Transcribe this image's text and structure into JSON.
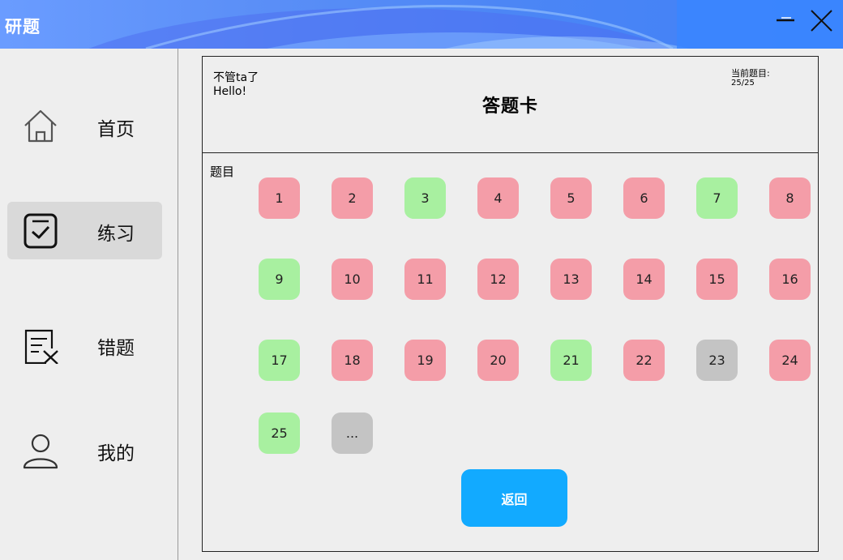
{
  "window": {
    "title": "研题"
  },
  "sidebar": {
    "items": [
      {
        "label": "首页",
        "icon": "home-icon"
      },
      {
        "label": "练习",
        "icon": "practice-check-icon",
        "active": true
      },
      {
        "label": "错题",
        "icon": "wrong-questions-icon"
      },
      {
        "label": "我的",
        "icon": "user-icon"
      }
    ]
  },
  "header": {
    "user_name": "不管ta了",
    "greeting": "Hello!",
    "title": "答题卡",
    "current_label": "当前题目:",
    "current_value": "25/25"
  },
  "questions": {
    "section_label": "题目",
    "items": [
      {
        "label": "1",
        "status": "wrong"
      },
      {
        "label": "2",
        "status": "wrong"
      },
      {
        "label": "3",
        "status": "right"
      },
      {
        "label": "4",
        "status": "wrong"
      },
      {
        "label": "5",
        "status": "wrong"
      },
      {
        "label": "6",
        "status": "wrong"
      },
      {
        "label": "7",
        "status": "right"
      },
      {
        "label": "8",
        "status": "wrong"
      },
      {
        "label": "9",
        "status": "right"
      },
      {
        "label": "10",
        "status": "wrong"
      },
      {
        "label": "11",
        "status": "wrong"
      },
      {
        "label": "12",
        "status": "wrong"
      },
      {
        "label": "13",
        "status": "wrong"
      },
      {
        "label": "14",
        "status": "wrong"
      },
      {
        "label": "15",
        "status": "wrong"
      },
      {
        "label": "16",
        "status": "wrong"
      },
      {
        "label": "17",
        "status": "right"
      },
      {
        "label": "18",
        "status": "wrong"
      },
      {
        "label": "19",
        "status": "wrong"
      },
      {
        "label": "20",
        "status": "wrong"
      },
      {
        "label": "21",
        "status": "right"
      },
      {
        "label": "22",
        "status": "wrong"
      },
      {
        "label": "23",
        "status": "none"
      },
      {
        "label": "24",
        "status": "wrong"
      },
      {
        "label": "25",
        "status": "right"
      },
      {
        "label": "...",
        "status": "none"
      }
    ]
  },
  "back_button": {
    "label": "返回"
  },
  "colors": {
    "wrong": "#f49da8",
    "right": "#a8f0a0",
    "none": "#c4c4c4",
    "accent": "#12aaff"
  }
}
